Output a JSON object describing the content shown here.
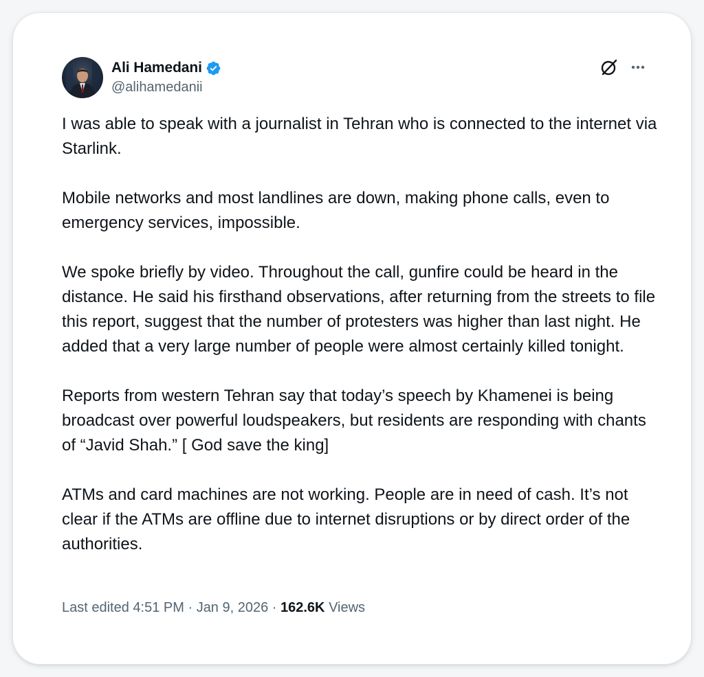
{
  "author": {
    "name": "Ali Hamedani",
    "handle": "@alihamedanii",
    "verified_color": "#1d9bf0",
    "avatar_icon": "profile-photo"
  },
  "actions": {
    "grok_icon": "grok-icon",
    "more_icon": "more-icon"
  },
  "tweet": {
    "paragraphs": [
      "I was able to speak with a journalist in Tehran who is connected to the internet via Starlink.",
      "Mobile networks and most landlines are down, making phone calls, even to emergency services, impossible.",
      "We spoke briefly by video. Throughout the call, gunfire could be heard in the distance. He said his firsthand observations, after returning from the streets to file this report, suggest that the number of protesters was higher than last night. He added that a very large number of people were almost certainly killed tonight.",
      "Reports from western Tehran say that today’s speech by Khamenei is being broadcast over powerful loudspeakers, but residents are responding with chants of “Javid Shah.” [ God save the king]",
      "ATMs and card machines are not working. People are in need of cash. It’s not clear if the ATMs are offline due to internet disruptions or by direct order of the authorities."
    ]
  },
  "meta": {
    "edited_label": "Last edited",
    "time": "4:51 PM",
    "date": "Jan 9, 2026",
    "separator": " · ",
    "views_count": "162.6K",
    "views_label": "Views"
  }
}
